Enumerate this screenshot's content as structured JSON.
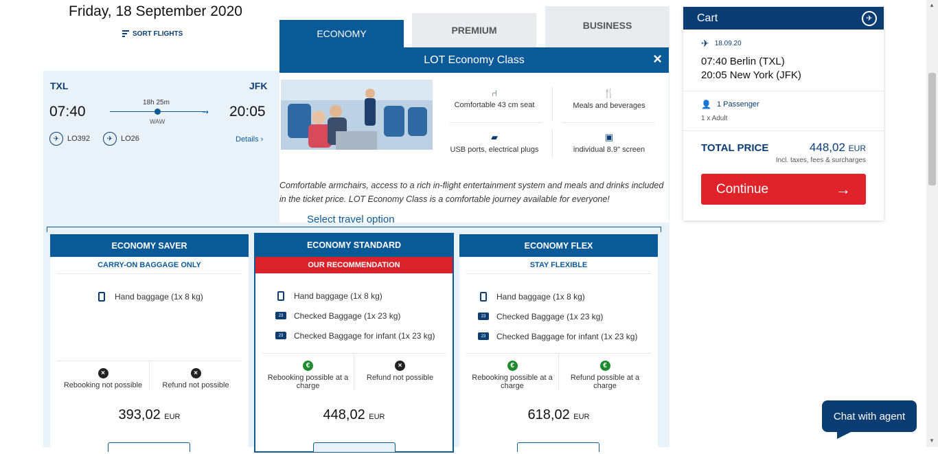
{
  "header": {
    "date": "Friday, 18 September 2020",
    "sort_label": "SORT FLIGHTS"
  },
  "tabs": [
    {
      "label": "ECONOMY"
    },
    {
      "label": "PREMIUM"
    },
    {
      "label": "BUSINESS"
    }
  ],
  "flight": {
    "from_code": "TXL",
    "to_code": "JFK",
    "dep_time": "07:40",
    "arr_time": "20:05",
    "duration": "18h 25m",
    "via": "WAW",
    "flight1": "LO392",
    "flight2": "LO26",
    "details_label": "Details ›"
  },
  "class_info": {
    "title": "LOT Economy Class",
    "close": "×",
    "amenities": [
      {
        "label": "Comfortable 43 cm seat",
        "icon": "seat-icon"
      },
      {
        "label": "Meals and beverages",
        "icon": "cutlery-icon"
      },
      {
        "label": "USB ports, electrical plugs",
        "icon": "plug-icon"
      },
      {
        "label": "individual 8.9\" screen",
        "icon": "screen-icon"
      }
    ],
    "description": "Comfortable armchairs, access to a rich in-flight entertainment system and meals and drinks included in the ticket price. LOT Economy Class is a comfortable journey available for everyone!"
  },
  "select_title": "Select travel option",
  "fares": [
    {
      "name": "ECONOMY SAVER",
      "subtitle": "CARRY-ON BAGGAGE ONLY",
      "bags": [
        "Hand baggage (1x 8 kg)"
      ],
      "rebooking": "Rebooking not possible",
      "refund": "Refund not possible",
      "price": "393,02",
      "currency": "EUR"
    },
    {
      "name": "ECONOMY STANDARD",
      "subtitle": "OUR RECOMMENDATION",
      "bags": [
        "Hand baggage (1x 8 kg)",
        "Checked Baggage (1x 23 kg)",
        "Checked Baggage for infant (1x 23 kg)"
      ],
      "rebooking": "Rebooking possible at a charge",
      "refund": "Refund not possible",
      "price": "448,02",
      "currency": "EUR"
    },
    {
      "name": "ECONOMY FLEX",
      "subtitle": "STAY FLEXIBLE",
      "bags": [
        "Hand baggage (1x 8 kg)",
        "Checked Baggage (1x 23 kg)",
        "Checked Baggage for infant (1x 23 kg)"
      ],
      "rebooking": "Rebooking possible at a charge",
      "refund": "Refund possible at a charge",
      "price": "618,02",
      "currency": "EUR"
    }
  ],
  "cart": {
    "title": "Cart",
    "date": "18.09.20",
    "route_from": "07:40 Berlin (TXL)",
    "route_to": "20:05 New York (JFK)",
    "passengers": "1 Passenger",
    "passenger_detail": "1 x Adult",
    "total_label": "TOTAL PRICE",
    "total_value": "448,02",
    "total_currency": "EUR",
    "total_note": "Incl. taxes, fees & surcharges",
    "continue_label": "Continue"
  },
  "chat_label": "Chat with agent",
  "colors": {
    "brand": "#0b3d73",
    "accent": "#0b5a98",
    "cta": "#e0232b"
  }
}
